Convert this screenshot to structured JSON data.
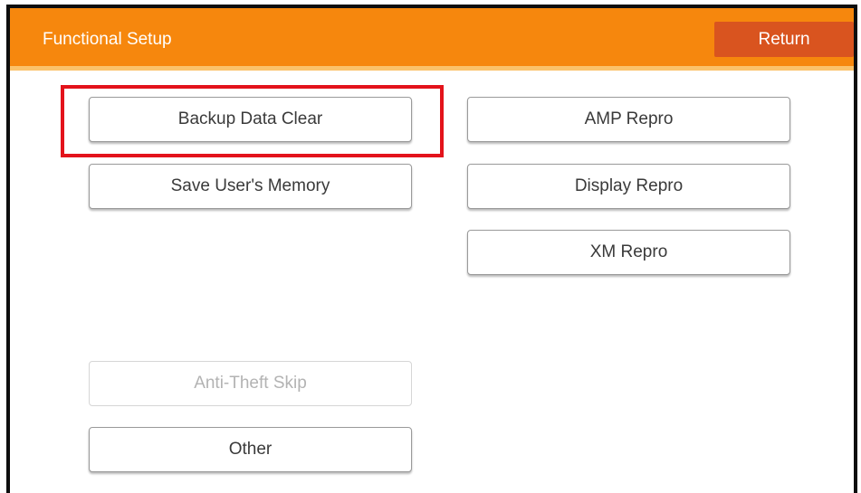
{
  "header": {
    "title": "Functional Setup",
    "return_label": "Return"
  },
  "left_column": {
    "backup_data_clear": "Backup Data Clear",
    "save_users_memory": "Save User's Memory",
    "anti_theft_skip": "Anti-Theft Skip",
    "other": "Other"
  },
  "right_column": {
    "amp_repro": "AMP Repro",
    "display_repro": "Display Repro",
    "xm_repro": "XM Repro"
  },
  "states": {
    "anti_theft_skip_enabled": false,
    "highlighted_button": "Backup Data Clear"
  },
  "colors": {
    "header_bg": "#f6870d",
    "header_accent": "#fbc26a",
    "return_button": "#d9541f",
    "highlight_box": "#e3131b"
  }
}
